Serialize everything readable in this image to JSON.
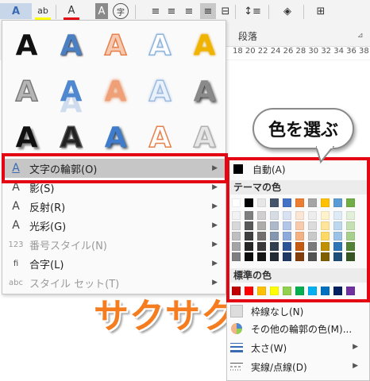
{
  "ribbon": {
    "group_label": "段落",
    "ruler_text": "18  20  22  24  26  28  30  32  34  36  38",
    "buttons": [
      {
        "name": "text-effects-icon",
        "glyph": "A"
      },
      {
        "name": "dropdown-icon",
        "glyph": "⌄"
      },
      {
        "name": "highlight-icon",
        "glyph": "ab"
      },
      {
        "name": "font-color-icon",
        "glyph": "A"
      },
      {
        "name": "char-shading-icon",
        "glyph": "A"
      },
      {
        "name": "enclose-char-icon",
        "glyph": "字"
      },
      {
        "name": "align-left-icon",
        "glyph": "≡"
      },
      {
        "name": "align-center-icon",
        "glyph": "≡"
      },
      {
        "name": "align-right-icon",
        "glyph": "≡"
      },
      {
        "name": "justify-icon",
        "glyph": "≡"
      },
      {
        "name": "distributed-icon",
        "glyph": "⊟"
      },
      {
        "name": "line-spacing-icon",
        "glyph": "↕≡"
      },
      {
        "name": "shading-icon",
        "glyph": "◈"
      },
      {
        "name": "borders-icon",
        "glyph": "⊞"
      }
    ]
  },
  "gallery": {
    "letter": "A",
    "styles": [
      {
        "fill": "#111111",
        "stroke": "none",
        "shadow": "none"
      },
      {
        "fill": "#4a7fc1",
        "stroke": "none",
        "shadow": "1px 1px 2px #223"
      },
      {
        "fill": "#f6c9b0",
        "stroke": "#e8804a",
        "shadow": "none"
      },
      {
        "fill": "#ffffff",
        "stroke": "#8fb4dd",
        "shadow": "0 0 3px #9bbfe6"
      },
      {
        "fill": "#f0b400",
        "stroke": "none",
        "shadow": "0 0 3px #d89b00"
      },
      {
        "fill": "#b5b5b5",
        "stroke": "#7a7a7a",
        "shadow": "none"
      },
      {
        "fill": "#4f88cf",
        "stroke": "none",
        "shadow": "0 14px 0 rgba(80,130,200,0.25)"
      },
      {
        "fill": "#f0a078",
        "stroke": "none",
        "shadow": "0 0 4px #e07a40"
      },
      {
        "fill": "#e9f1fb",
        "stroke": "#9ebce0",
        "shadow": "0 0 4px #9ebce0"
      },
      {
        "fill": "#8a8a8a",
        "stroke": "none",
        "shadow": "2px 2px 3px #444"
      },
      {
        "fill": "#111111",
        "stroke": "none",
        "shadow": "3px 3px 2px #888"
      },
      {
        "fill": "#222222",
        "stroke": "#555",
        "shadow": "1px 2px 2px #777"
      },
      {
        "fill": "#3f7ccc",
        "stroke": "none",
        "shadow": "2px 2px 3px #345"
      },
      {
        "fill": "#ffffff",
        "stroke": "#e8804a",
        "shadow": "none"
      },
      {
        "fill": "#e6e6e6",
        "stroke": "#b0b0b0",
        "shadow": "1px 1px 2px #999"
      }
    ]
  },
  "menu": {
    "items": [
      {
        "name": "menu-item-outline",
        "icon": "A",
        "label": "文字の輪郭(O)",
        "arrow": "▶",
        "disabled": false
      },
      {
        "name": "menu-item-shadow",
        "icon": "A",
        "label": "影(S)",
        "arrow": "▶",
        "disabled": false
      },
      {
        "name": "menu-item-reflection",
        "icon": "A",
        "label": "反射(R)",
        "arrow": "▶",
        "disabled": false
      },
      {
        "name": "menu-item-glow",
        "icon": "A",
        "label": "光彩(G)",
        "arrow": "▶",
        "disabled": false
      },
      {
        "name": "menu-item-number-style",
        "icon": "123",
        "label": "番号スタイル(N)",
        "arrow": "▶",
        "disabled": true
      },
      {
        "name": "menu-item-ligature",
        "icon": "fi",
        "label": "合字(L)",
        "arrow": "▶",
        "disabled": false
      },
      {
        "name": "menu-item-stylistic-set",
        "icon": "abc",
        "label": "スタイル セット(T)",
        "arrow": "▶",
        "disabled": true
      }
    ]
  },
  "color_menu": {
    "auto_label": "自動(A)",
    "theme_label": "テーマの色",
    "standard_label": "標準の色",
    "theme_top": [
      "#ffffff",
      "#000000",
      "#e7e6e6",
      "#44546a",
      "#4472c4",
      "#ed7d31",
      "#a5a5a5",
      "#ffc000",
      "#5b9bd5",
      "#70ad47"
    ],
    "theme_shades": [
      [
        "#f2f2f2",
        "#7f7f7f",
        "#d0cece",
        "#d6dce4",
        "#d9e2f3",
        "#fbe5d5",
        "#ededed",
        "#fff2cc",
        "#deebf6",
        "#e2efd9"
      ],
      [
        "#d8d8d8",
        "#595959",
        "#aeabab",
        "#adb9ca",
        "#b4c6e7",
        "#f7cbac",
        "#dbdbdb",
        "#fee599",
        "#bdd7ee",
        "#c5e0b3"
      ],
      [
        "#bfbfbf",
        "#3f3f3f",
        "#757070",
        "#8496b0",
        "#8eaadb",
        "#f4b183",
        "#c9c9c9",
        "#ffd965",
        "#9cc3e5",
        "#a8d08d"
      ],
      [
        "#a5a5a5",
        "#262626",
        "#3a3838",
        "#323f4f",
        "#2f5496",
        "#c55a11",
        "#7b7b7b",
        "#bf9000",
        "#2e75b5",
        "#538135"
      ],
      [
        "#7f7f7f",
        "#0c0c0c",
        "#171616",
        "#222a35",
        "#1f3864",
        "#833c0b",
        "#525252",
        "#7f6000",
        "#1e4e79",
        "#375623"
      ]
    ],
    "standard": [
      "#c00000",
      "#ff0000",
      "#ffc000",
      "#ffff00",
      "#92d050",
      "#00b050",
      "#00b0f0",
      "#0070c0",
      "#002060",
      "#7030a0"
    ]
  },
  "lower_menu": {
    "items": [
      {
        "name": "menu-item-no-outline",
        "label": "枠線なし(N)",
        "arrow": ""
      },
      {
        "name": "menu-item-more-outline-colors",
        "label": "その他の輪郭の色(M)...",
        "arrow": ""
      },
      {
        "name": "menu-item-weight",
        "label": "太さ(W)",
        "arrow": "▶"
      },
      {
        "name": "menu-item-dashes",
        "label": "実線/点線(D)",
        "arrow": "▶"
      }
    ]
  },
  "callout": {
    "text": "色を選ぶ"
  },
  "doc_text": "サクサク"
}
